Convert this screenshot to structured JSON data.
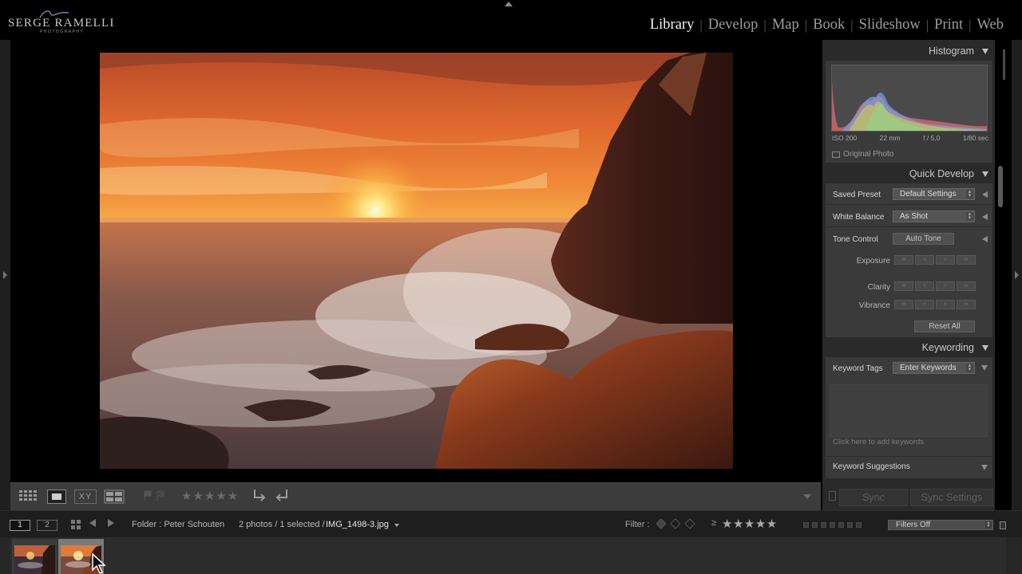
{
  "logo": {
    "name": "SERGE RAMELLI",
    "sub": "PHOTOGRAPHY"
  },
  "modules": [
    {
      "label": "Library",
      "active": true
    },
    {
      "label": "Develop",
      "active": false
    },
    {
      "label": "Map",
      "active": false
    },
    {
      "label": "Book",
      "active": false
    },
    {
      "label": "Slideshow",
      "active": false
    },
    {
      "label": "Print",
      "active": false
    },
    {
      "label": "Web",
      "active": false
    }
  ],
  "toolbar": {
    "compare_label": "XY",
    "rating_stars": "★★★★★"
  },
  "histogram": {
    "title": "Histogram",
    "iso": "ISO 200",
    "focal": "22 mm",
    "aperture": "f / 5,0",
    "shutter": "1/80 sec",
    "original_photo": "Original Photo"
  },
  "quick_develop": {
    "title": "Quick Develop",
    "saved_preset_label": "Saved Preset",
    "saved_preset_value": "Default Settings",
    "white_balance_label": "White Balance",
    "white_balance_value": "As Shot",
    "tone_control_label": "Tone Control",
    "auto_tone": "Auto Tone",
    "exposure_label": "Exposure",
    "clarity_label": "Clarity",
    "vibrance_label": "Vibrance",
    "reset_all": "Reset All"
  },
  "keywording": {
    "title": "Keywording",
    "keyword_tags_label": "Keyword Tags",
    "keyword_tags_value": "Enter Keywords",
    "add_placeholder": "Click here to add keywords",
    "suggestions": "Keyword Suggestions"
  },
  "sync": {
    "sync": "Sync",
    "sync_settings": "Sync Settings"
  },
  "filmstrip_bar": {
    "view1": "1",
    "view2": "2",
    "folder": "Folder : Peter Schouten",
    "count": "2 photos / 1 selected /",
    "file": "IMG_1498-3.jpg",
    "filter_label": "Filter :",
    "geq": "≥",
    "stars": "★★★★★",
    "filters_value": "Filters Off"
  },
  "colors": {
    "panel_bg": "#2a2a2a",
    "section_bg": "#3a3a3a",
    "accent_active": "#f2f2f2"
  }
}
